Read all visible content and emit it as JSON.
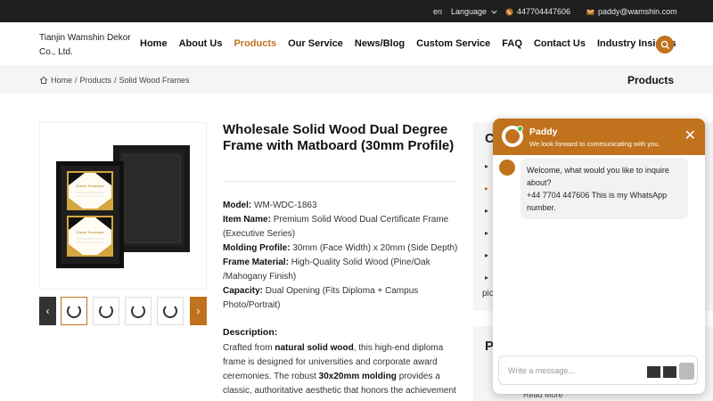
{
  "topbar": {
    "lang_code": "en",
    "language_label": "Language",
    "phone": "447704447606",
    "email": "paddy@wamshin.com"
  },
  "brand": "Tianjin Wamshin Dekor Co., Ltd.",
  "nav": [
    {
      "label": "Home"
    },
    {
      "label": "About Us"
    },
    {
      "label": "Products"
    },
    {
      "label": "Our Service"
    },
    {
      "label": "News/Blog"
    },
    {
      "label": "Custom Service"
    },
    {
      "label": "FAQ"
    },
    {
      "label": "Contact Us"
    },
    {
      "label": "Industry Insights"
    }
  ],
  "breadcrumb": {
    "items": [
      "Home",
      "/",
      "Products",
      "/",
      "Solid Wood Frames"
    ],
    "page_title": "Products"
  },
  "product": {
    "title": "Wholesale Solid Wood Dual Degree Frame with Matboard (30mm Profile)",
    "specs": [
      {
        "label": "Model:",
        "value": "WM-WDC-1863"
      },
      {
        "label": "Item Name:",
        "value": "Premium Solid Wood Dual Certificate Frame (Executive Series)"
      },
      {
        "label": "Molding Profile:",
        "value": "30mm (Face Width) x 20mm (Side Depth)"
      },
      {
        "label": "Frame Material:",
        "value": "High-Quality Solid Wood (Pine/Oak /Mahogany Finish)"
      },
      {
        "label": "Capacity:",
        "value": "Dual Opening (Fits Diploma + Campus Photo/Portrait)"
      }
    ],
    "description_heading": "Description:",
    "description": {
      "p1": "Crafted from ",
      "b1": "natural solid wood",
      "p2": ", this high-end diploma frame is designed for universities and corporate award ceremonies. The robust ",
      "b2": "30x20mm molding",
      "p3": " provides a classic, authoritative aesthetic that honors the achievement"
    },
    "certificate_text": "Name Surname"
  },
  "sidebar": {
    "heading_partial": "C",
    "bullets": [
      "▸",
      "▸",
      "▸",
      "▸",
      "▸",
      "▸"
    ],
    "text_fragment": "pic",
    "heading2_partial": "P",
    "read_more": "Read More"
  },
  "chat": {
    "agent_name": "Paddy",
    "subtitle": "We look forward to communicating with you.",
    "close": "✕",
    "message_line1": "Welcome, what would you like to inquire about?",
    "message_line2": "+44 7704 447606 This is my WhatsApp number.",
    "input_placeholder": "Write a message..."
  },
  "colors": {
    "accent": "#c0721d",
    "topbar_bg": "#1f1f1f",
    "online": "#3ec04f"
  }
}
